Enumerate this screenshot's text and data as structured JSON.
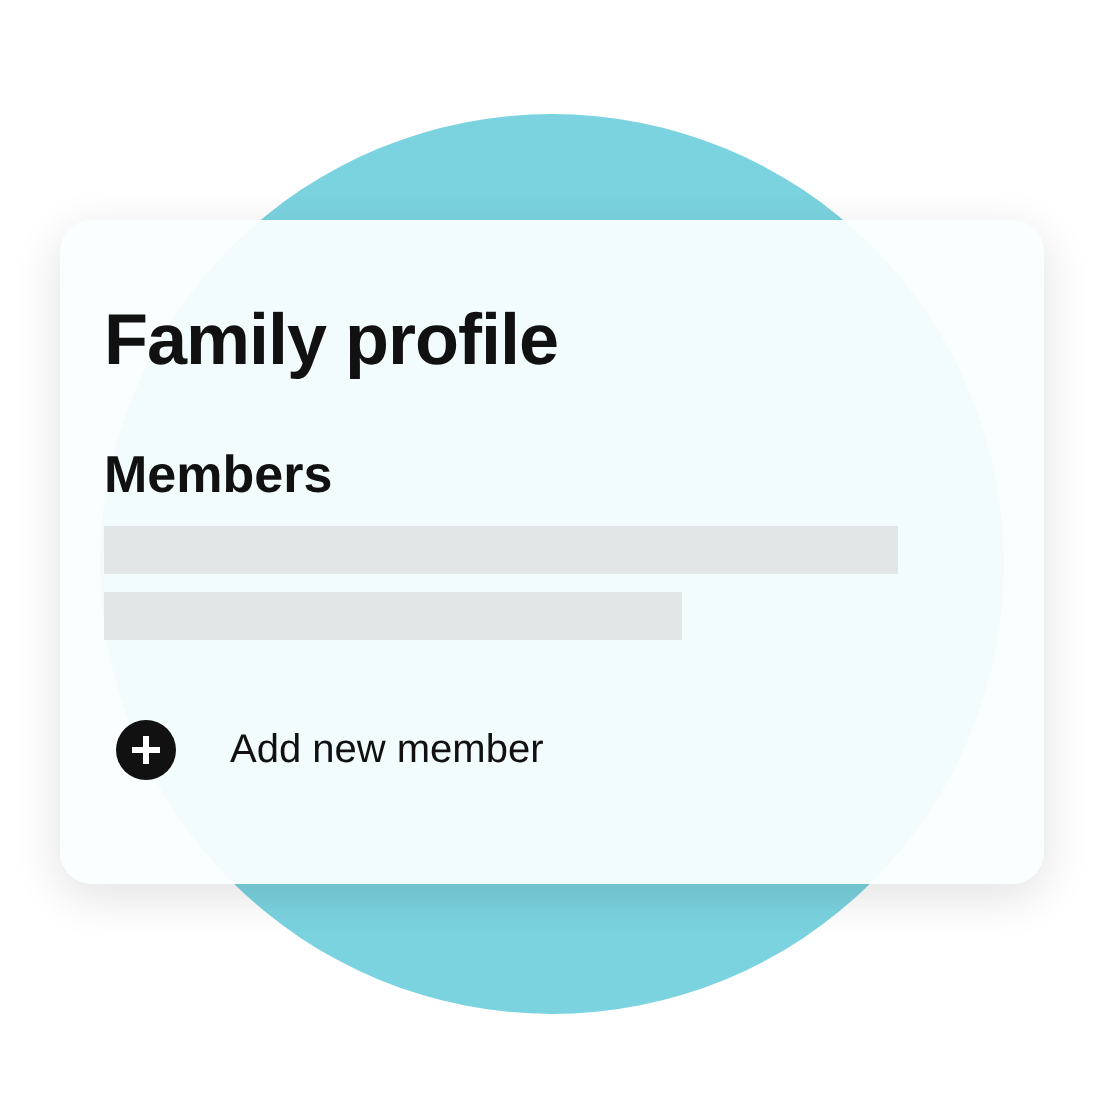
{
  "card": {
    "title": "Family profile",
    "section": {
      "heading": "Members",
      "skeleton_lines": [
        {
          "kind": "long"
        },
        {
          "kind": "short"
        }
      ]
    },
    "add_action": {
      "label": "Add new member"
    }
  }
}
